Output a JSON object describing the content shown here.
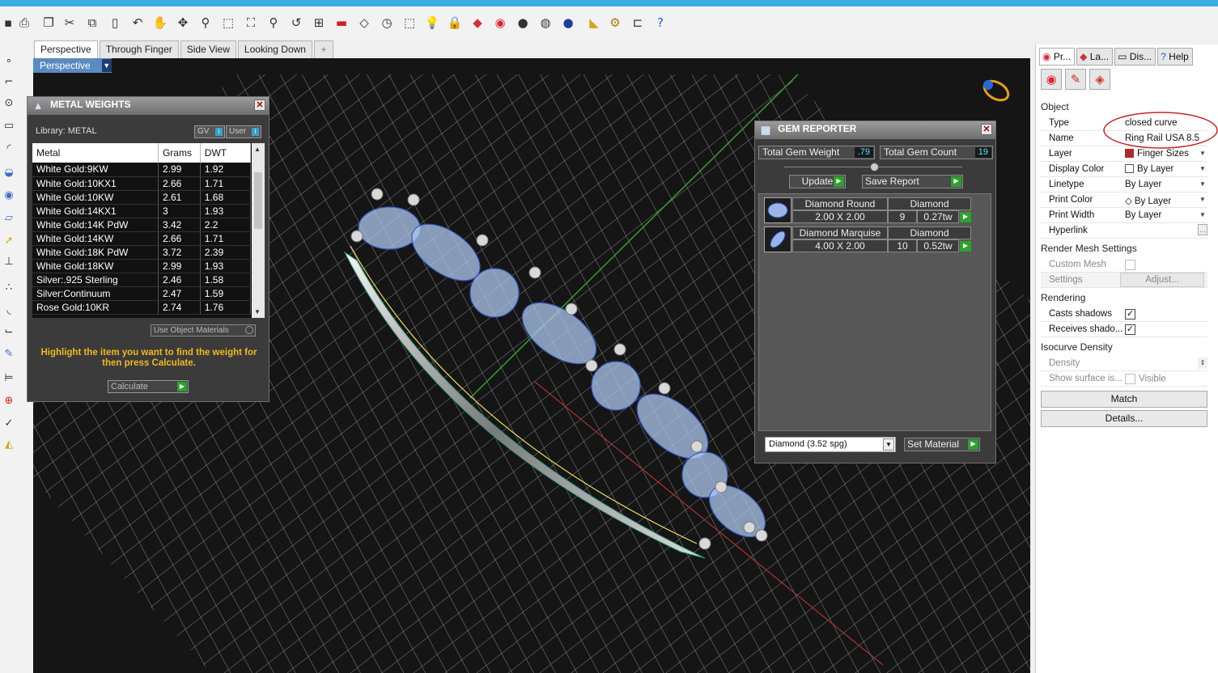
{
  "viewport": {
    "tabs": [
      "Perspective",
      "Through Finger",
      "Side View",
      "Looking Down"
    ],
    "active_tab": "Perspective",
    "label": "Perspective"
  },
  "metal_weights": {
    "title": "METAL WEIGHTS",
    "library": "Library: METAL",
    "toggle_gv": "GV",
    "toggle_user": "User",
    "columns": [
      "Metal",
      "Grams",
      "DWT"
    ],
    "rows": [
      [
        "White Gold:9KW",
        "2.99",
        "1.92"
      ],
      [
        "White Gold:10KX1",
        "2.66",
        "1.71"
      ],
      [
        "White Gold:10KW",
        "2.61",
        "1.68"
      ],
      [
        "White Gold:14KX1",
        "3",
        "1.93"
      ],
      [
        "White Gold:14K PdW",
        "3.42",
        "2.2"
      ],
      [
        "White Gold:14KW",
        "2.66",
        "1.71"
      ],
      [
        "White Gold:18K PdW",
        "3.72",
        "2.39"
      ],
      [
        "White Gold:18KW",
        "2.99",
        "1.93"
      ],
      [
        "Silver:.925 Sterling",
        "2.46",
        "1.58"
      ],
      [
        "Silver:Continuum",
        "2.47",
        "1.59"
      ],
      [
        "Rose Gold:10KR",
        "2.74",
        "1.76"
      ]
    ],
    "use_object_materials": "Use Object Materials",
    "hint": "Highlight the item you want to find the weight for then press Calculate.",
    "calculate": "Calculate"
  },
  "gem_reporter": {
    "title": "GEM REPORTER",
    "total_weight_label": "Total Gem Weight",
    "total_weight_value": ".79",
    "total_count_label": "Total Gem Count",
    "total_count_value": "19",
    "update": "Update",
    "save_report": "Save Report",
    "gems": [
      {
        "shape": "Diamond Round",
        "material": "Diamond",
        "size": "2.00 X 2.00",
        "count": "9",
        "weight": "0.27tw"
      },
      {
        "shape": "Diamond Marquise",
        "material": "Diamond",
        "size": "4.00 X 2.00",
        "count": "10",
        "weight": "0.52tw"
      }
    ],
    "material_select": "Diamond    (3.52 spg)",
    "set_material": "Set Material"
  },
  "properties": {
    "tabs": [
      "Pr...",
      "La...",
      "Dis...",
      "Help"
    ],
    "section_object": "Object",
    "rows": [
      {
        "key": "Type",
        "value": "closed curve"
      },
      {
        "key": "Name",
        "value": "Ring Rail USA 8.5"
      },
      {
        "key": "Layer",
        "value": "Finger Sizes"
      },
      {
        "key": "Display Color",
        "value": "By Layer"
      },
      {
        "key": "Linetype",
        "value": "By Layer"
      },
      {
        "key": "Print Color",
        "value": "By Layer"
      },
      {
        "key": "Print Width",
        "value": "By Layer"
      },
      {
        "key": "Hyperlink",
        "value": ""
      }
    ],
    "section_render_mesh": "Render Mesh Settings",
    "custom_mesh": "Custom Mesh",
    "settings": "Settings",
    "adjust": "Adjust...",
    "section_rendering": "Rendering",
    "casts_shadows": "Casts shadows",
    "receives_shadows": "Receives shado...",
    "section_isocurve": "Isocurve Density",
    "density": "Density",
    "show_surface": "Show surface is...",
    "visible": "Visible",
    "match": "Match",
    "details": "Details..."
  },
  "colors": {
    "accent": "#3aaee0",
    "viewport_label": "#5a8ac0",
    "hint": "#f0b820",
    "highlight_circle": "#c0282a"
  }
}
